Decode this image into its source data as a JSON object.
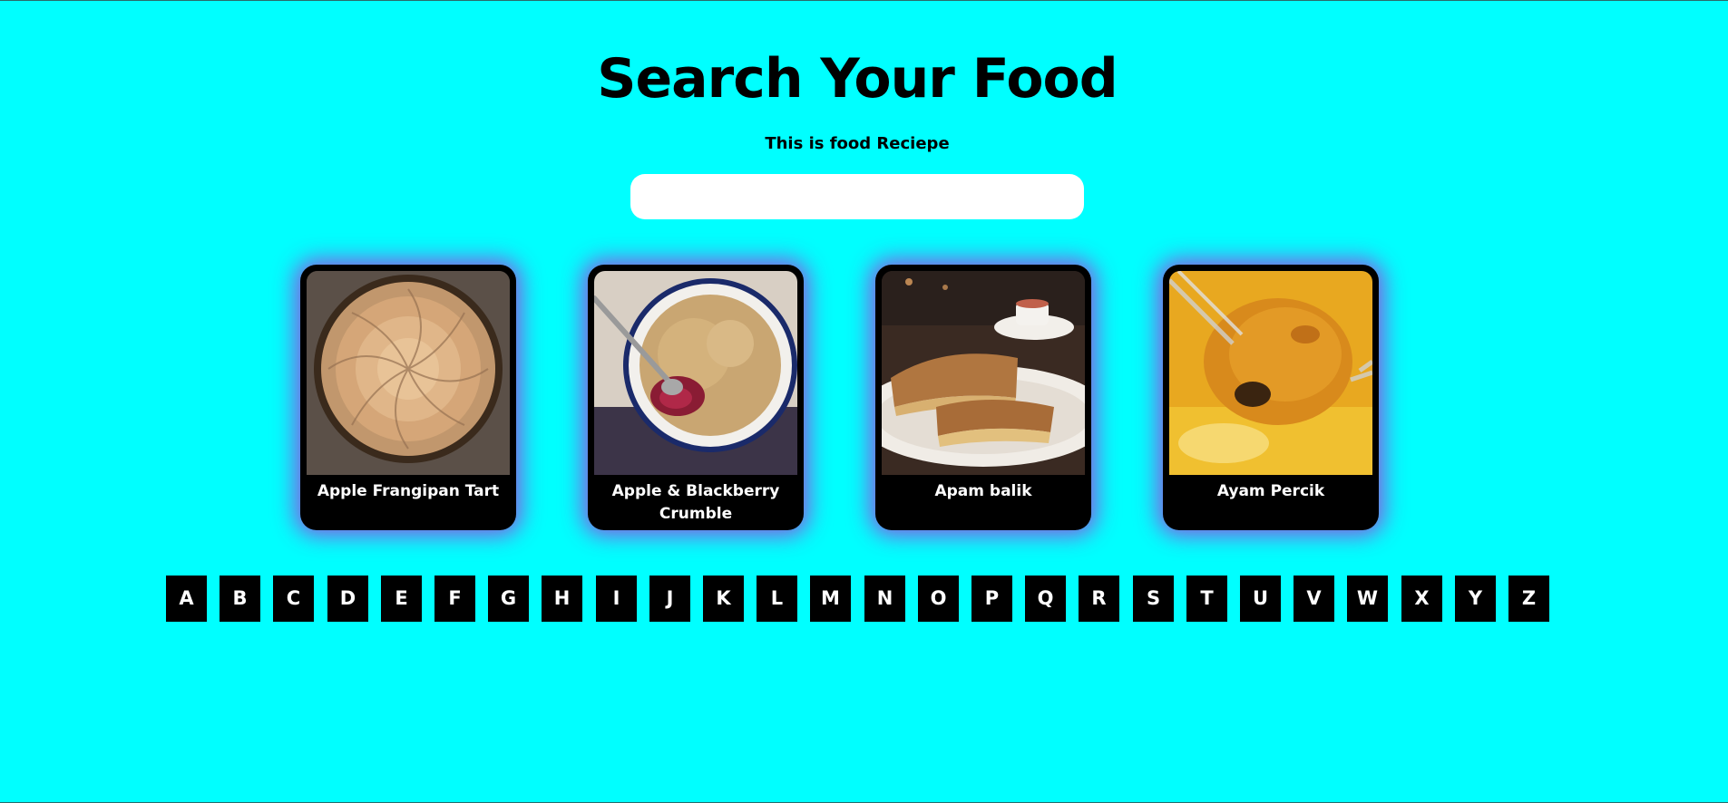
{
  "header": {
    "title": "Search Your Food",
    "subtitle": "This is food Reciepe"
  },
  "search": {
    "value": "",
    "placeholder": ""
  },
  "meals": [
    {
      "name": "Apple Frangipan Tart",
      "image_icon": "apple-frangipan-tart-photo"
    },
    {
      "name": "Apple & Blackberry Crumble",
      "image_icon": "apple-blackberry-crumble-photo"
    },
    {
      "name": "Apam balik",
      "image_icon": "apam-balik-photo"
    },
    {
      "name": "Ayam Percik",
      "image_icon": "ayam-percik-photo"
    }
  ],
  "letters": [
    "A",
    "B",
    "C",
    "D",
    "E",
    "F",
    "G",
    "H",
    "I",
    "J",
    "K",
    "L",
    "M",
    "N",
    "O",
    "P",
    "Q",
    "R",
    "S",
    "T",
    "U",
    "V",
    "W",
    "X",
    "Y",
    "Z"
  ],
  "colors": {
    "background": "#00ffff",
    "card": "#000000",
    "card_glow": "#a03cdc",
    "letter_bg": "#000000",
    "letter_text": "#ffffff"
  }
}
